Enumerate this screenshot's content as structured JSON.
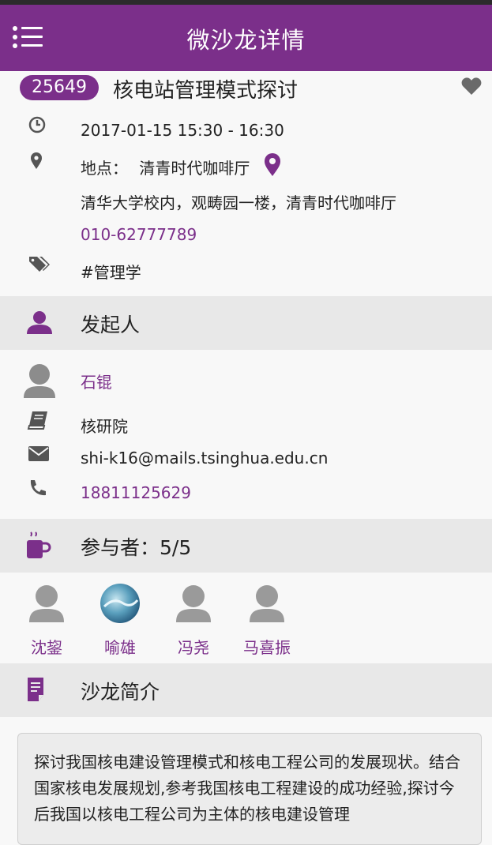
{
  "header": {
    "title": "微沙龙详情",
    "menu_icon": "menu-icon"
  },
  "event": {
    "id": "25649",
    "title": "核电站管理模式探讨",
    "time": "2017-01-15 15:30 - 16:30",
    "location_label": "地点：",
    "location_name": "清青时代咖啡厅",
    "address": "清华大学校内，观畴园一楼，清青时代咖啡厅",
    "phone": "010-62777789",
    "tag": "#管理学"
  },
  "organizer_section": {
    "title": "发起人"
  },
  "organizer": {
    "name": "石锟",
    "department": "核研院",
    "email": "shi-k16@mails.tsinghua.edu.cn",
    "phone": "18811125629"
  },
  "participants_section": {
    "title": "参与者：5/5"
  },
  "participants": [
    {
      "name": "沈鋆"
    },
    {
      "name": "喻雄"
    },
    {
      "name": "冯尧"
    },
    {
      "name": "马喜振"
    }
  ],
  "intro_section": {
    "title": "沙龙简介"
  },
  "intro": {
    "text": "探讨我国核电建设管理模式和核电工程公司的发展现状。结合国家核电发展规划,参考我国核电工程建设的成功经验,探讨今后我国以核电工程公司为主体的核电建设管理"
  },
  "colors": {
    "accent": "#7b2f8a",
    "section_bg": "#e8e8e8",
    "page_bg": "#f8f8f8"
  }
}
